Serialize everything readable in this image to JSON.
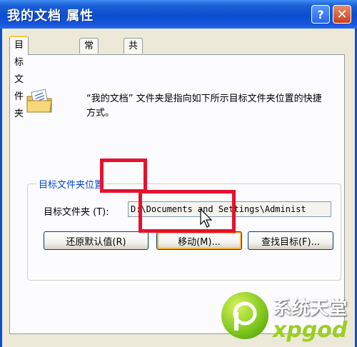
{
  "titlebar": {
    "title": "我的文档 属性",
    "help_label": "?",
    "close_label": "✕"
  },
  "tabs": [
    {
      "label": "目标文件夹",
      "active": true
    },
    {
      "label": "常规",
      "active": false
    },
    {
      "label": "共享",
      "active": false
    }
  ],
  "description": "“我的文档” 文件夹是指向如下所示目标文件夹位置的快捷方式。",
  "group": {
    "title": "目标文件夹位置",
    "target_label": "目标文件夹 (T):",
    "target_value": "D:\\Documents and Settings\\Administ"
  },
  "buttons": {
    "restore": "还原默认值(R)",
    "move": "移动(M)...",
    "find": "查找目标(F)..."
  },
  "watermark": {
    "line1": "系统天堂",
    "line2": "xpgod"
  },
  "colors": {
    "title_bar": "#0b4ed0",
    "highlight": "#e8102d",
    "logo_green": "#7cc51c"
  }
}
